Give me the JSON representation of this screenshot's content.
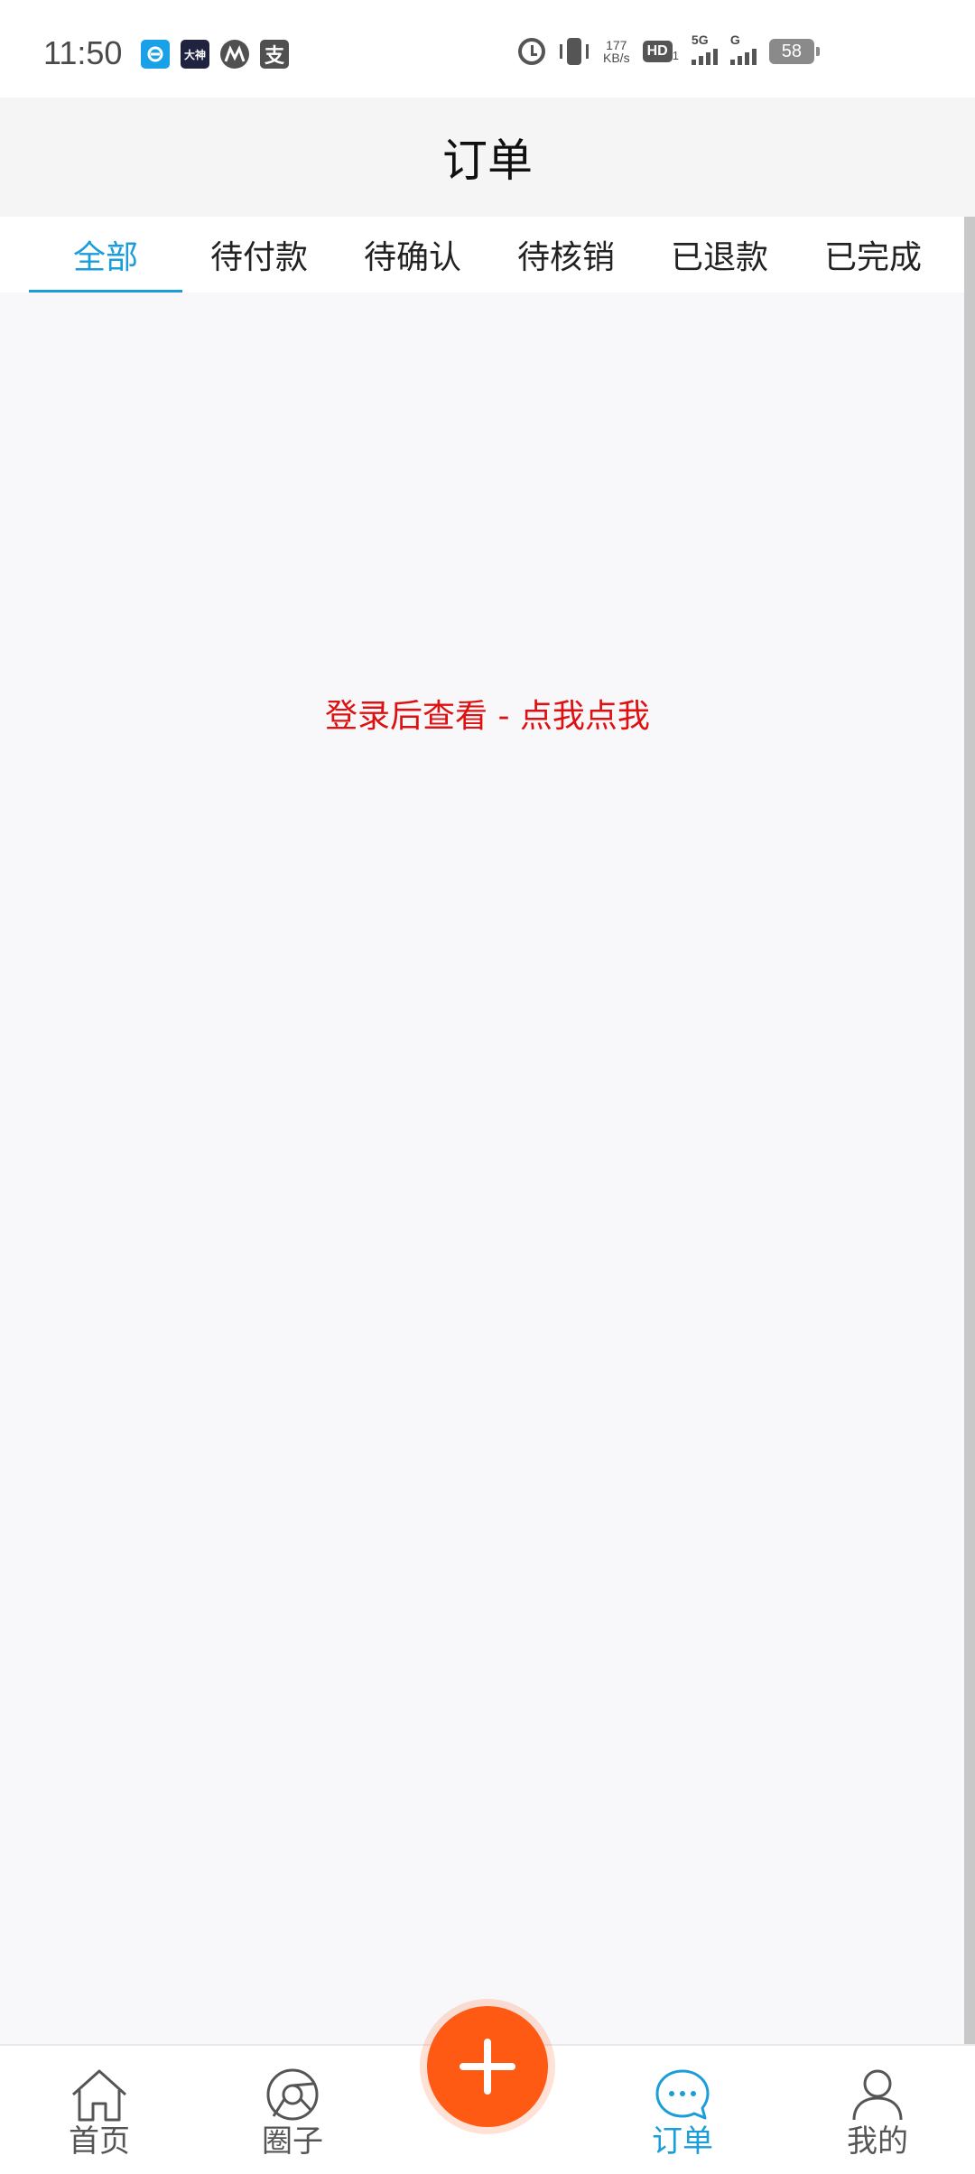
{
  "status_bar": {
    "time": "11:50",
    "notification_icons": [
      "eleme-icon",
      "dashen-icon",
      "metro-icon",
      "alipay-icon"
    ],
    "alipay_glyph": "支",
    "dashen_glyph": "大神",
    "net_speed_value": "177",
    "net_speed_unit": "KB/s",
    "hd_label": "HD",
    "hd_sub": "1",
    "signal1_label": "5G",
    "signal2_label": "G",
    "battery": "58"
  },
  "header": {
    "title": "订单"
  },
  "tabs": [
    {
      "label": "全部",
      "active": true
    },
    {
      "label": "待付款",
      "active": false
    },
    {
      "label": "待确认",
      "active": false
    },
    {
      "label": "待核销",
      "active": false
    },
    {
      "label": "已退款",
      "active": false
    },
    {
      "label": "已完成",
      "active": false
    }
  ],
  "content": {
    "login_prompt": "登录后查看 - 点我点我"
  },
  "bottom_nav": {
    "items": [
      {
        "label": "首页",
        "icon": "home-icon"
      },
      {
        "label": "圈子",
        "icon": "circle-icon"
      },
      {
        "label": "订单",
        "icon": "chat-icon",
        "active": true
      },
      {
        "label": "我的",
        "icon": "user-icon"
      }
    ],
    "fab_icon": "plus-icon"
  },
  "colors": {
    "accent": "#1a9dd9",
    "fab": "#ff5a14",
    "prompt": "#dd1111",
    "background": "#f8f8fa"
  }
}
